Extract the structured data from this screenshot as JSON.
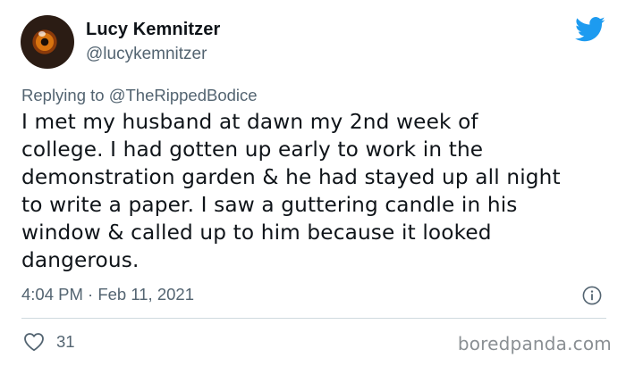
{
  "tweet": {
    "author": {
      "display_name": "Lucy Kemnitzer",
      "handle": "@lucykemnitzer",
      "avatar_icon": "eye-avatar"
    },
    "reply": {
      "prefix": "Replying to",
      "mention": "@TheRippedBodice"
    },
    "text_lines": [
      "I met my husband at dawn my 2nd week of",
      "college. I had gotten up early to work in the",
      "demonstration garden & he had stayed up all night",
      "to write a paper. I saw a guttering candle in his",
      "window & called up to him because it looked",
      "dangerous."
    ],
    "timestamp": "4:04 PM · Feb 11, 2021",
    "likes": "31",
    "icons": {
      "brand": "twitter-bird-icon",
      "info": "info-icon",
      "like": "heart-icon"
    },
    "colors": {
      "brand_blue": "#1d9bf0",
      "secondary_text": "#536471",
      "primary_text": "#0f1419"
    }
  },
  "watermark": "boredpanda.com"
}
